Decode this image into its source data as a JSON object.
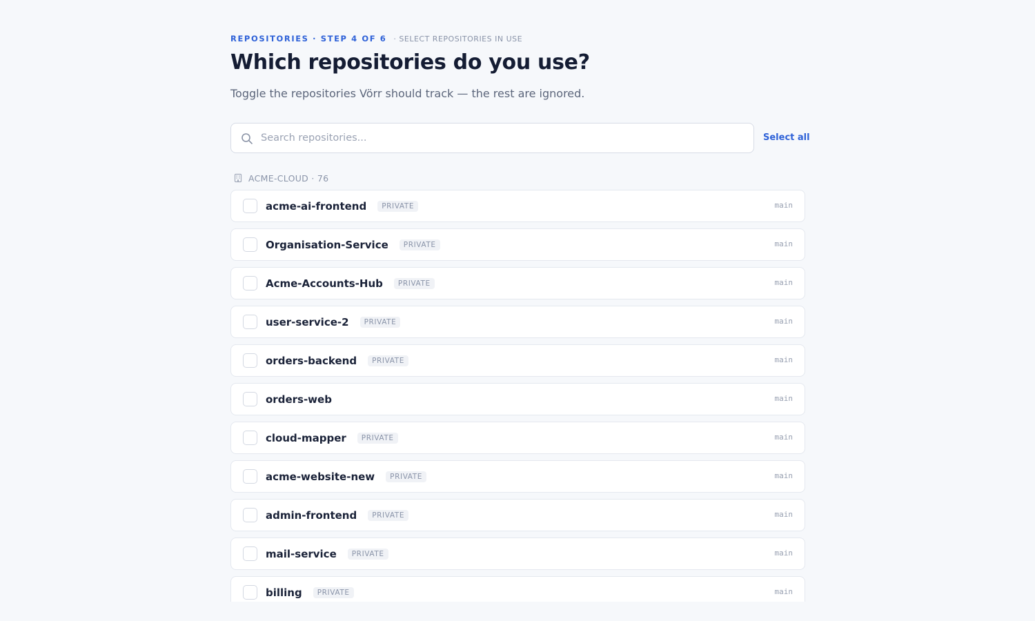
{
  "header": {
    "step_label": "REPOSITORIES · STEP 4 OF 6",
    "step_desc": "· SELECT REPOSITORIES IN USE",
    "title": "Which repositories do you use?",
    "subtitle": "Toggle the repositories Vörr should track — the rest are ignored."
  },
  "search": {
    "placeholder": "Search repositories...",
    "value": "",
    "icon": "search-icon"
  },
  "select_all_label": "Select all",
  "group": {
    "icon": "building-icon",
    "label": "ACME-CLOUD · 76"
  },
  "colors": {
    "accent": "#2f62d8",
    "background": "#f6f8fb",
    "text": "#141c33",
    "muted": "#8993a8"
  },
  "repos": [
    {
      "name": "acme-ai-frontend",
      "badge": "PRIVATE",
      "branch": "main",
      "checked": false
    },
    {
      "name": "Organisation-Service",
      "badge": "PRIVATE",
      "branch": "main",
      "checked": false
    },
    {
      "name": "Acme-Accounts-Hub",
      "badge": "PRIVATE",
      "branch": "main",
      "checked": false
    },
    {
      "name": "user-service-2",
      "badge": "PRIVATE",
      "branch": "main",
      "checked": false
    },
    {
      "name": "orders-backend",
      "badge": "PRIVATE",
      "branch": "main",
      "checked": false
    },
    {
      "name": "orders-web",
      "badge": "",
      "branch": "main",
      "checked": false
    },
    {
      "name": "cloud-mapper",
      "badge": "PRIVATE",
      "branch": "main",
      "checked": false
    },
    {
      "name": "acme-website-new",
      "badge": "PRIVATE",
      "branch": "main",
      "checked": false
    },
    {
      "name": "admin-frontend",
      "badge": "PRIVATE",
      "branch": "main",
      "checked": false
    },
    {
      "name": "mail-service",
      "badge": "PRIVATE",
      "branch": "main",
      "checked": false
    },
    {
      "name": "billing",
      "badge": "PRIVATE",
      "branch": "main",
      "checked": false
    }
  ]
}
